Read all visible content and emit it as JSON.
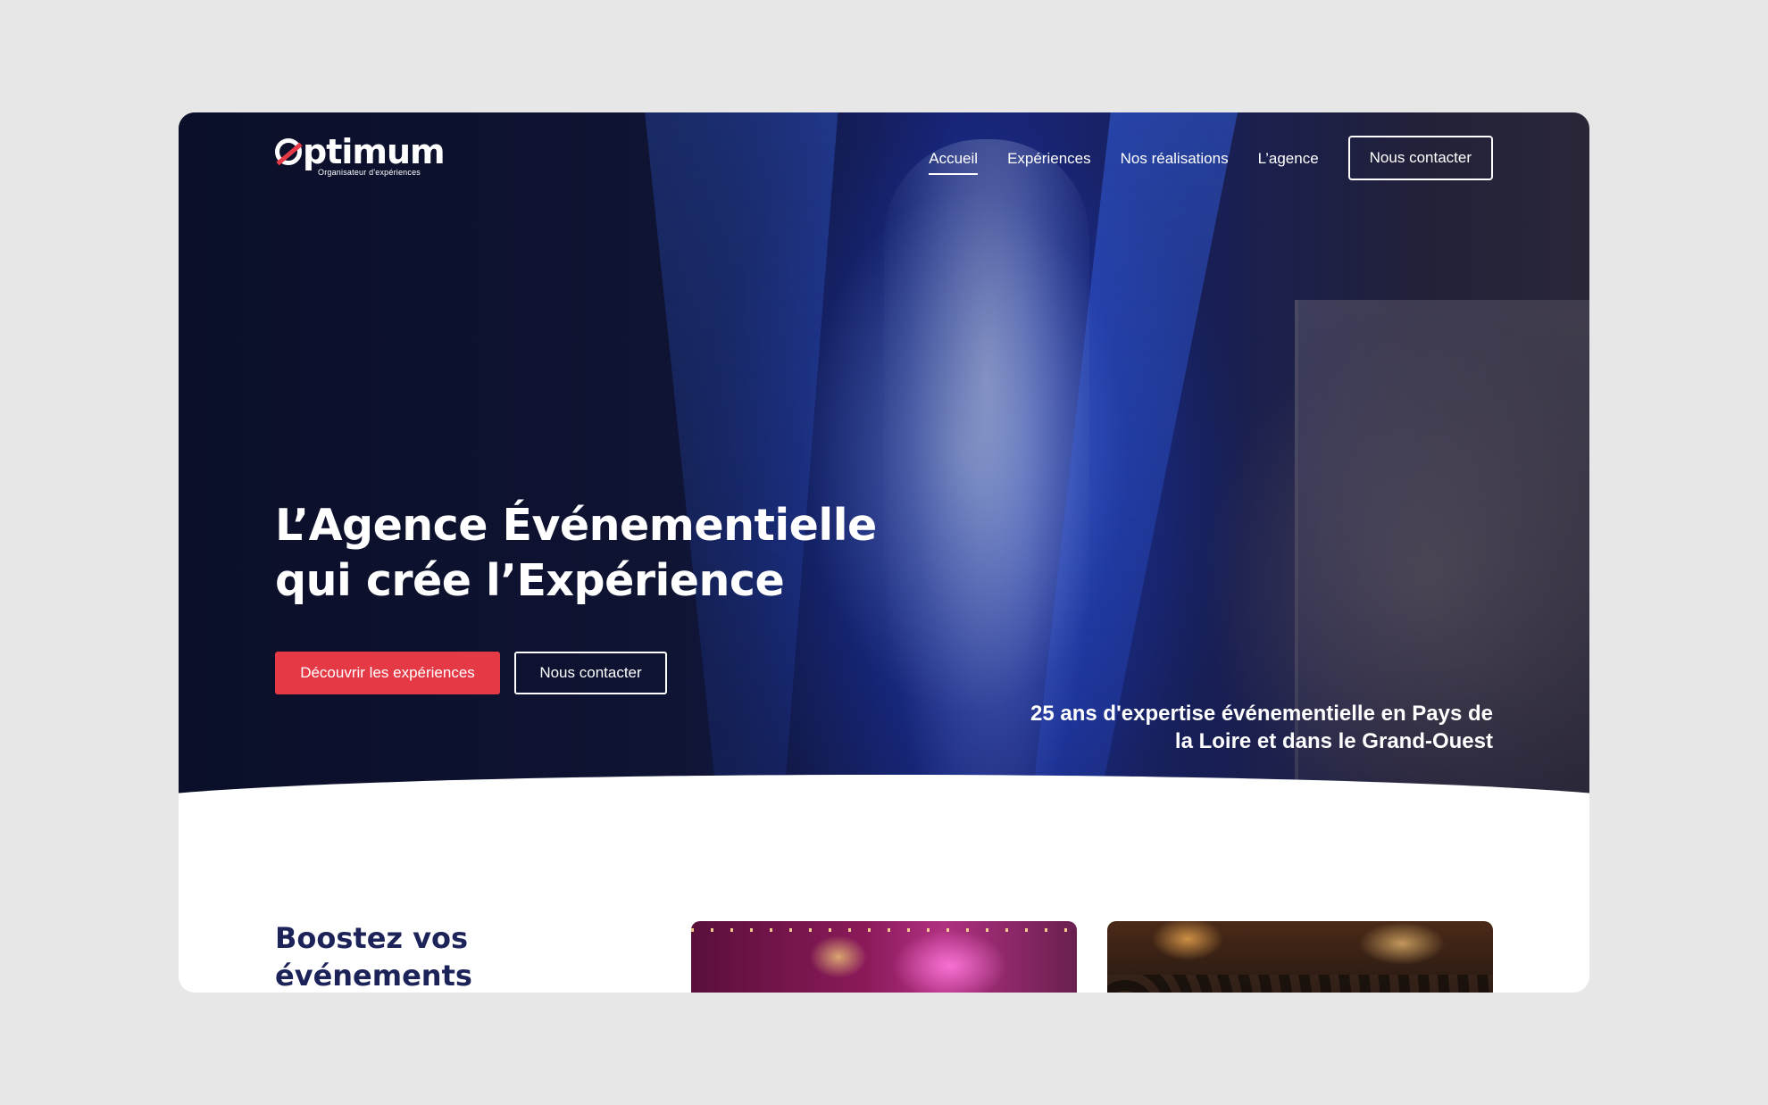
{
  "brand": {
    "name": "ptimum",
    "tagline": "Organisateur d'expériences",
    "accent_color": "#e63946",
    "navy_color": "#1c2359"
  },
  "nav": {
    "items": [
      {
        "label": "Accueil",
        "active": true
      },
      {
        "label": "Expériences",
        "active": false
      },
      {
        "label": "Nos réalisations",
        "active": false
      },
      {
        "label": "L’agence",
        "active": false
      }
    ],
    "cta_label": "Nous contacter"
  },
  "hero": {
    "title_line1": "L’Agence Événementielle",
    "title_line2": "qui crée l’Expérience",
    "primary_button": "Découvrir les expériences",
    "secondary_button": "Nous contacter",
    "subtitle_line1": "25 ans d'expertise événementielle en Pays de",
    "subtitle_line2": "la Loire et dans le Grand-Ouest"
  },
  "section": {
    "title_line1": "Boostez vos",
    "title_line2": "événements"
  }
}
